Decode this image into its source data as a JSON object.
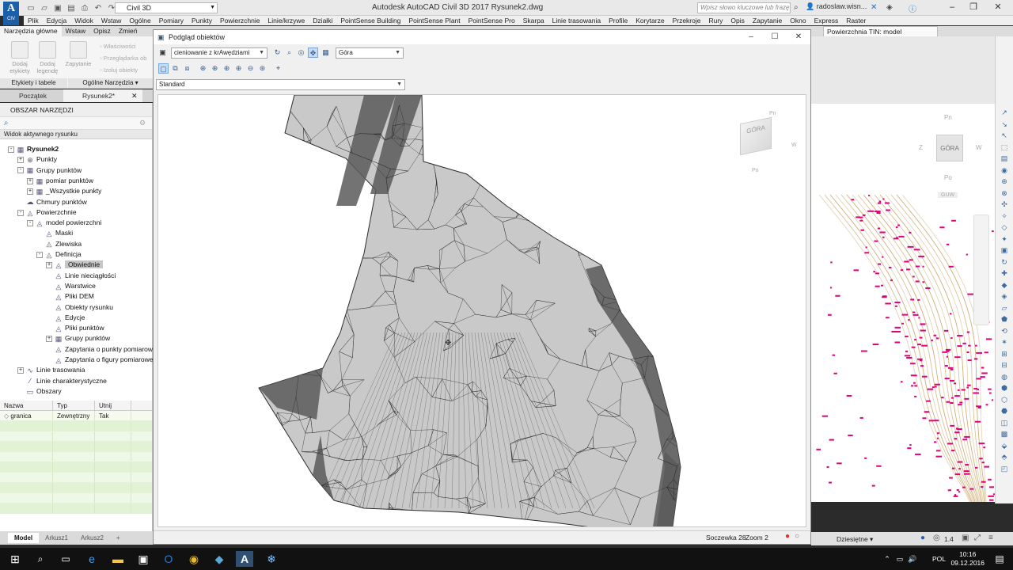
{
  "app": {
    "logo_text": "A",
    "logo_sub": "CIV",
    "workspace": "Civil 3D",
    "title": "Autodesk AutoCAD Civil 3D 2017     Rysunek2.dwg",
    "search_placeholder": "Wpisz słowo kluczowe lub frazę",
    "user": "radoslaw.wisn..."
  },
  "menubar": [
    "Plik",
    "Edycja",
    "Widok",
    "Wstaw",
    "Ogólne",
    "Pomiary",
    "Punkty",
    "Powierzchnie",
    "Linie/krzywe",
    "Działki",
    "PointSense Building",
    "PointSense Plant",
    "PointSense Pro",
    "Skarpa",
    "Linie trasowania",
    "Profile",
    "Korytarze",
    "Przekroje",
    "Rury",
    "Opis",
    "Zapytanie",
    "Okno",
    "Express",
    "Raster"
  ],
  "ribbon_tabs": [
    "Narzędzia główne",
    "Wstaw",
    "Opisz",
    "Zmień"
  ],
  "context_tab": "Powierzchnia TIN: model powierzchni",
  "ribbon": {
    "btn_add_labels": "Dodaj etykiety",
    "btn_add_legend": "Dodaj legendę",
    "btn_query": "Zapytanie",
    "btn_properties": "Właściwości",
    "btn_browse": "Przeglądarka ob",
    "btn_isolate": "Izoluj obiekty",
    "group_labels": "Etykiety i tabele",
    "group_tools": "Ogólne Narzędzia ▾"
  },
  "doc_tabs": [
    "Początek",
    "Rysunek2*"
  ],
  "toolspace": {
    "header": "OBSZAR NARZĘDZI",
    "view": "Widok aktywnego rysunku",
    "tree": [
      {
        "label": "Rysunek2",
        "level": 0,
        "exp": "-",
        "bold": true
      },
      {
        "label": "Punkty",
        "level": 1,
        "exp": "+"
      },
      {
        "label": "Grupy punktów",
        "level": 1,
        "exp": "-"
      },
      {
        "label": "pomiar punktów",
        "level": 2,
        "exp": "+"
      },
      {
        "label": "_Wszystkie punkty",
        "level": 2,
        "exp": "+"
      },
      {
        "label": "Chmury punktów",
        "level": 1,
        "exp": ""
      },
      {
        "label": "Powierzchnie",
        "level": 1,
        "exp": "-"
      },
      {
        "label": "model powierzchni",
        "level": 2,
        "exp": "-"
      },
      {
        "label": "Maski",
        "level": 3,
        "exp": ""
      },
      {
        "label": "Zlewiska",
        "level": 3,
        "exp": ""
      },
      {
        "label": "Definicja",
        "level": 3,
        "exp": "-"
      },
      {
        "label": "Obwiednie",
        "level": 4,
        "exp": "+",
        "sel": true
      },
      {
        "label": "Linie nieciągłości",
        "level": 4,
        "exp": ""
      },
      {
        "label": "Warstwice",
        "level": 4,
        "exp": ""
      },
      {
        "label": "Pliki DEM",
        "level": 4,
        "exp": ""
      },
      {
        "label": "Obiekty rysunku",
        "level": 4,
        "exp": ""
      },
      {
        "label": "Edycje",
        "level": 4,
        "exp": ""
      },
      {
        "label": "Pliki punktów",
        "level": 4,
        "exp": ""
      },
      {
        "label": "Grupy punktów",
        "level": 4,
        "exp": "+"
      },
      {
        "label": "Zapytania o punkty pomiarowe",
        "level": 4,
        "exp": ""
      },
      {
        "label": "Zapytania o figury pomiarowe",
        "level": 4,
        "exp": ""
      },
      {
        "label": "Linie trasowania",
        "level": 1,
        "exp": "+"
      },
      {
        "label": "Linie charakterystyczne",
        "level": 1,
        "exp": ""
      },
      {
        "label": "Obszary",
        "level": 1,
        "exp": ""
      }
    ]
  },
  "grid": {
    "columns": [
      "Nazwa",
      "Typ",
      "Utnij"
    ],
    "rows": [
      [
        "granica",
        "Zewnętrzny",
        "Tak"
      ]
    ]
  },
  "layout_tabs": [
    "Model",
    "Arkusz1",
    "Arkusz2",
    "+"
  ],
  "preview": {
    "title": "Podgląd obiektów",
    "style_combo": "cieniowanie z krAwędziami",
    "view_combo": "Góra",
    "visual_combo": "Standard",
    "status_lens": "Soczewka 28",
    "status_zoom": "Zoom 2"
  },
  "viewcube": {
    "top": "GÓRA",
    "n": "Pn",
    "s": "Po",
    "e": "W",
    "w": "Z",
    "wcs": "GUW"
  },
  "statusbar": {
    "units": "Dziesiętne ▾",
    "scale": "1.4"
  },
  "taskbar": {
    "time": "10:16",
    "date": "09.12.2016",
    "lang": "POL"
  },
  "colors": {
    "mesh_line": "#2a2a2a",
    "mesh_fill": "#c9c9c9",
    "mesh_dark": "#5a5a5a",
    "contour": "#c8a060",
    "points": "#e0007a"
  }
}
